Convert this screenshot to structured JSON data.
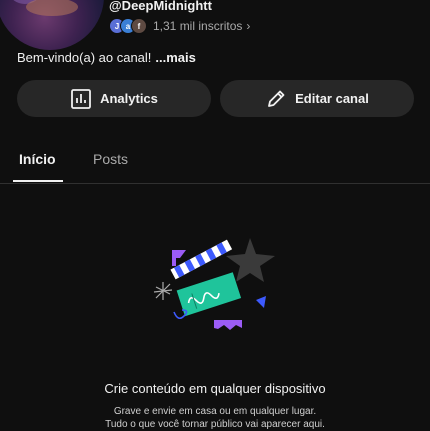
{
  "channel": {
    "handle": "@DeepMidnightt",
    "subscribers": "1,31 mil inscritos",
    "avatar_initials": [
      "J",
      "a",
      "f"
    ],
    "avatar_colors": [
      "#5a6fd6",
      "#3b7fd6",
      "#5e4a42"
    ],
    "description": "Bem-vindo(a) ao canal!",
    "more_label": "...mais"
  },
  "actions": {
    "analytics_label": "Analytics",
    "edit_label": "Editar canal"
  },
  "tabs": [
    {
      "label": "Início",
      "selected": true
    },
    {
      "label": "Posts",
      "selected": false
    }
  ],
  "empty_state": {
    "title": "Crie conteúdo em qualquer dispositivo",
    "subtitle_line1": "Grave e envie em casa ou em qualquer lugar.",
    "subtitle_line2": "Tudo o que você tornar público vai aparecer aqui."
  },
  "colors": {
    "background": "#0f0f0f",
    "button": "#272727",
    "clapper_green": "#1fc49b",
    "accent_blue": "#3d5afe",
    "accent_purple": "#9b5cf6"
  },
  "icons": [
    "analytics-icon",
    "pencil-icon",
    "chevron-right-icon",
    "clapperboard-illustration"
  ]
}
